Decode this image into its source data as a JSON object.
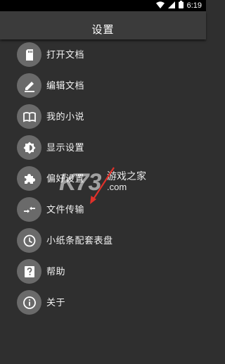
{
  "status_bar": {
    "time": "6:19",
    "icons": [
      "wifi-icon",
      "signal-icon",
      "battery-icon"
    ]
  },
  "app_bar": {
    "title": "设置"
  },
  "menu": {
    "items": [
      {
        "label": "打开文档",
        "icon": "sd-card-icon"
      },
      {
        "label": "编辑文档",
        "icon": "pencil-icon"
      },
      {
        "label": "我的小说",
        "icon": "book-icon"
      },
      {
        "label": "显示设置",
        "icon": "brightness-icon"
      },
      {
        "label": "偏好设置",
        "icon": "puzzle-icon"
      },
      {
        "label": "文件传输",
        "icon": "transfer-icon"
      },
      {
        "label": "小纸条配套表盘",
        "icon": "clock-icon"
      },
      {
        "label": "帮助",
        "icon": "help-icon"
      },
      {
        "label": "关于",
        "icon": "info-icon"
      }
    ]
  },
  "watermark": {
    "logo": "K73",
    "name": "游戏之家",
    "domain": ".com"
  },
  "colors": {
    "background": "#2f2f2f",
    "app_bar": "#3b3b3b",
    "icon_circle": "#6a6a6a",
    "arrow": "#e0312a"
  }
}
